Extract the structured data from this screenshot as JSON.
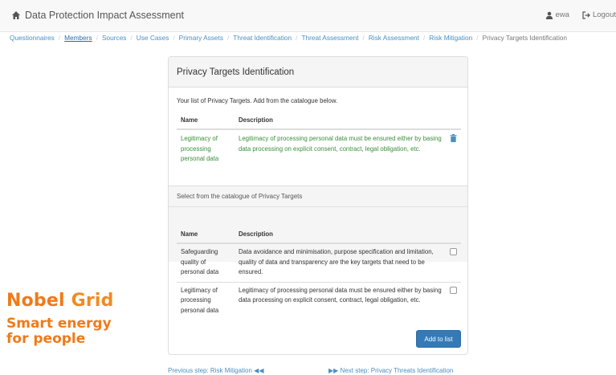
{
  "navbar": {
    "title": "Data Protection Impact Assessment",
    "user": "ewa",
    "logout": "Logout"
  },
  "breadcrumb": [
    "Questionnaires",
    "Members",
    "Sources",
    "Use Cases",
    "Primary Assets",
    "Threat Identification",
    "Threat Assessment",
    "Risk Assessment",
    "Risk Mitigation",
    "Privacy Targets Identification"
  ],
  "panel": {
    "title": "Privacy Targets Identification",
    "intro": "Your list of Privacy Targets. Add from the catalogue below.",
    "headers": {
      "name": "Name",
      "description": "Description"
    },
    "selected": [
      {
        "name": "Legitimacy of processing personal data",
        "description": "Legitimacy of processing personal data must be ensured either by basing data processing on explicit consent, contract, legal obligation, etc."
      }
    ],
    "catalogue_label": "Select from the catalogue of Privacy Targets",
    "catalogue": [
      {
        "name": "Safeguarding quality of personal data",
        "description": "Data avoidance and minimisation, purpose specification and limitation, quality of data and transparency are the key targets that need to be ensured."
      },
      {
        "name": "Legitimacy of processing personal data",
        "description": "Legitimacy of processing personal data must be ensured either by basing data processing on explicit consent, contract, legal obligation, etc."
      }
    ],
    "add_button": "Add to list"
  },
  "footer": {
    "prev": "Previous step: Risk Mitigation",
    "next": "Next step: Privacy Threats Identification"
  },
  "logo": {
    "word1": "Nobel",
    "word2": "Grid",
    "tagline1": "Smart energy",
    "tagline2": "for people"
  },
  "colors": {
    "accent": "#337ab7",
    "link": "#4a8fc2",
    "selected_text": "#3a8f3a",
    "logo": "#f07a1a"
  }
}
